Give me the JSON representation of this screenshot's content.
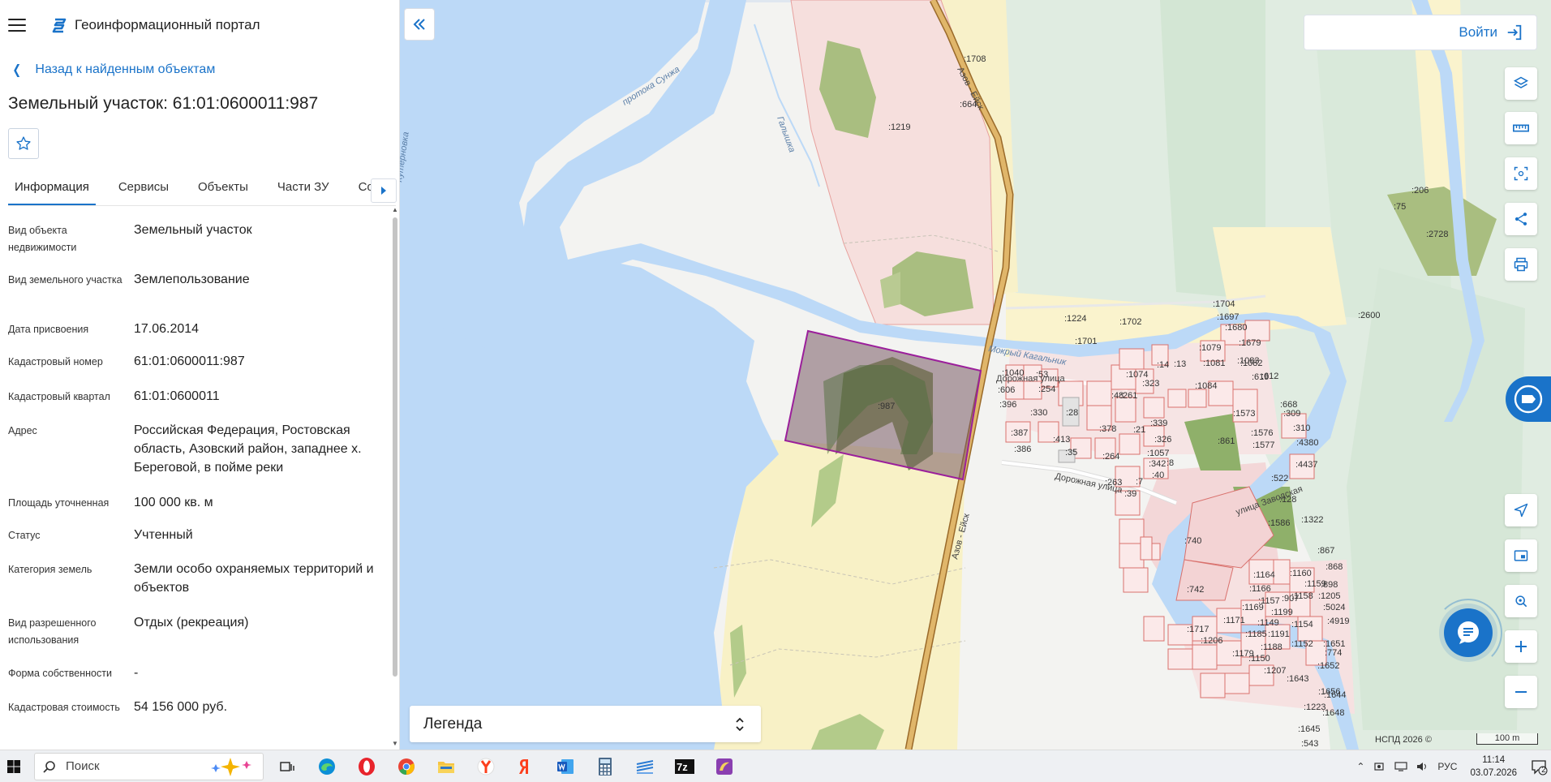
{
  "app": {
    "title": "Геоинформационный портал"
  },
  "nav": {
    "back_label": "Назад к найденным объектам"
  },
  "object": {
    "title": "Земельный участок: 61:01:0600011:987"
  },
  "tabs": [
    {
      "label": "Информация"
    },
    {
      "label": "Сервисы"
    },
    {
      "label": "Объекты"
    },
    {
      "label": "Части ЗУ"
    },
    {
      "label": "Состав"
    }
  ],
  "info": [
    {
      "label": "Вид объекта недвижимости",
      "value": "Земельный участок"
    },
    {
      "label": "Вид земельного участка",
      "value": "Землепользование"
    },
    {
      "label": "Дата присвоения",
      "value": "17.06.2014"
    },
    {
      "label": "Кадастровый номер",
      "value": "61:01:0600011:987"
    },
    {
      "label": "Кадастровый квартал",
      "value": "61:01:0600011"
    },
    {
      "label": "Адрес",
      "value": "Российская Федерация, Ростовская область, Азовский район, западнее х. Береговой, в пойме реки"
    },
    {
      "label": "Площадь уточненная",
      "value": "100 000 кв. м"
    },
    {
      "label": "Статус",
      "value": "Учтенный"
    },
    {
      "label": "Категория земель",
      "value": "Земли особо охраняемых территорий и объектов"
    },
    {
      "label": "Вид разрешенного использования",
      "value": "Отдых (рекреация)"
    },
    {
      "label": "Форма собственности",
      "value": "-"
    },
    {
      "label": "Кадастровая стоимость",
      "value": "54 156 000 руб."
    }
  ],
  "login": {
    "label": "Войти"
  },
  "legend": {
    "label": "Легенда"
  },
  "map": {
    "attribution": "НСПД 2026 ©",
    "scale": "100 m",
    "water_labels": [
      "протока Сунжа",
      "Кутерновка",
      "Галышка",
      "Мокрый Кагальник"
    ],
    "road_labels": [
      "Азов - Ейск",
      "Азов - Ейск",
      "Дорожная улица",
      "Дорожная улица",
      "улица Заводская"
    ],
    "parcel_labels": [
      ":1708",
      ":664",
      ":1219",
      ":987",
      ":1224",
      ":1702",
      ":1701",
      ":1704",
      ":1697",
      ":1680",
      ":1679",
      ":1079",
      ":1081",
      ":1082",
      ":1083",
      ":619",
      ":612",
      ":1084",
      ":1074",
      ":14",
      ":13",
      ":323",
      ":261",
      ":1040",
      ":53",
      ":254",
      ":606",
      ":396",
      ":330",
      ":28",
      ":48",
      ":378",
      ":21",
      ":339",
      ":387",
      ":413",
      ":386",
      ":35",
      ":1573",
      ":1576",
      ":1577",
      ":861",
      ":668",
      ":309",
      ":310",
      ":4380",
      ":4437",
      ":264",
      ":1057",
      ":342",
      ":8",
      ":326",
      ":40",
      ":7",
      ":263",
      ":39",
      ":522",
      ":128",
      ":1586",
      ":1322",
      ":740",
      ":867",
      ":868",
      ":742",
      ":1164",
      ":1160",
      ":1166",
      ":1159",
      ":1158",
      ":898",
      ":907",
      ":1205",
      ":1157",
      ":5024",
      ":1169",
      ":1199",
      ":4919",
      ":1171",
      ":1149",
      ":1154",
      ":1717",
      ":1185",
      ":1191",
      ":1651",
      ":1206",
      ":1188",
      ":1152",
      ":774",
      ":1179",
      ":1150",
      ":1652",
      ":1207",
      ":1643",
      ":1656",
      ":1644",
      ":1223",
      ":1648",
      ":1645",
      ":543",
      ":206",
      ":75",
      ":2728",
      ":2600"
    ]
  },
  "taskbar": {
    "search_placeholder": "Поиск",
    "lang": "РУС",
    "time": "11:14",
    "date": "03.07.2026",
    "notif_count": "2"
  },
  "colors": {
    "accent": "#1a73c9",
    "water": "#bcd9f7",
    "parcel_highlight": "#9b1f9b",
    "forest": "#a9be80",
    "pink_zone": "#f5dedd",
    "yellow_zone": "#faf2c6",
    "road": "#d9a85a"
  }
}
